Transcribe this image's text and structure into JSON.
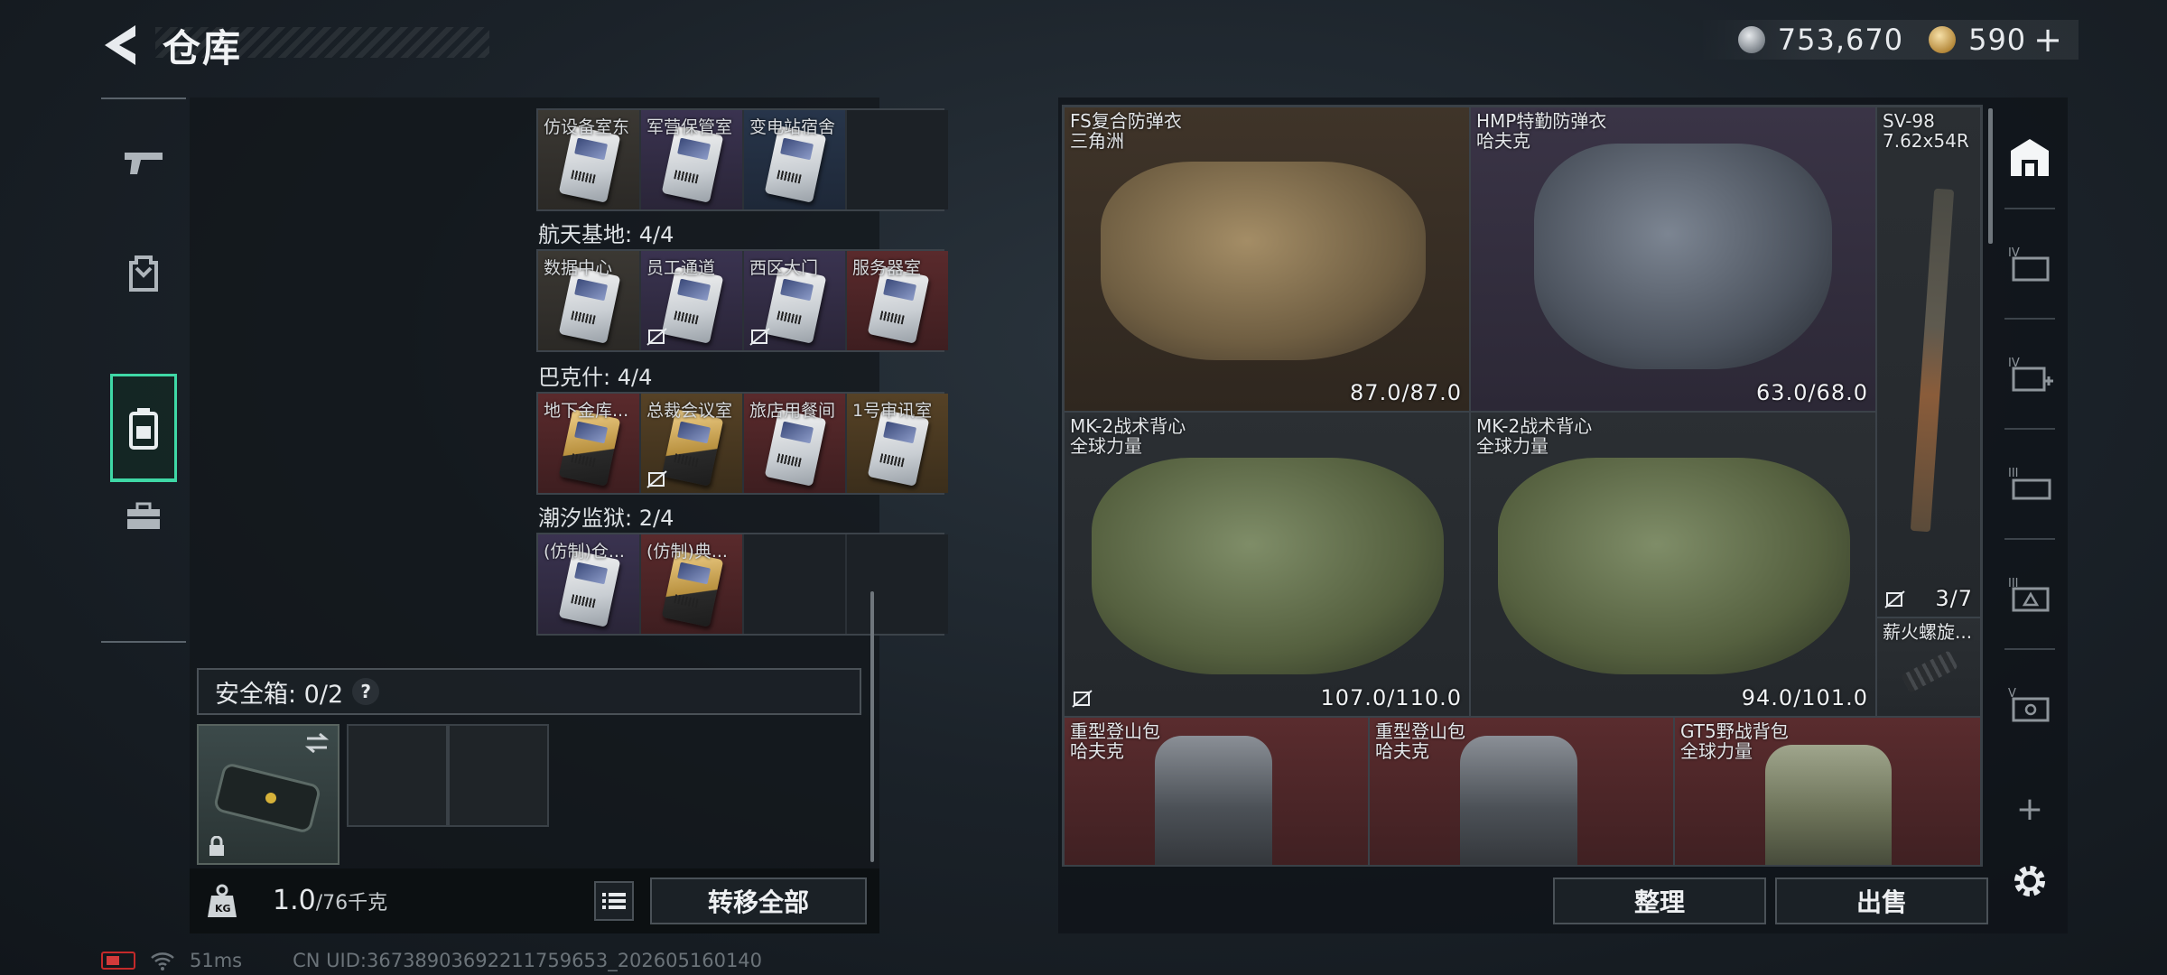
{
  "header": {
    "title": "仓库"
  },
  "currency": {
    "silver": "753,670",
    "gold": "590",
    "plus": "+"
  },
  "keys": {
    "row0": [
      {
        "label": "仿设备室东",
        "color": "grey",
        "card": "white",
        "nodrop": false
      },
      {
        "label": "军营保管室",
        "color": "purple",
        "card": "white",
        "nodrop": false
      },
      {
        "label": "变电站宿舍",
        "color": "blue",
        "card": "white",
        "nodrop": false
      },
      {
        "label": "",
        "color": "empty"
      }
    ],
    "groups": [
      {
        "title": "航天基地: 4/4",
        "cells": [
          {
            "label": "数据中心",
            "color": "grey",
            "card": "white",
            "nodrop": false
          },
          {
            "label": "员工通道",
            "color": "purple",
            "card": "white",
            "nodrop": true
          },
          {
            "label": "西区大门",
            "color": "purple",
            "card": "white",
            "nodrop": true
          },
          {
            "label": "服务器室",
            "color": "red",
            "card": "white",
            "nodrop": false
          }
        ]
      },
      {
        "title": "巴克什: 4/4",
        "cells": [
          {
            "label": "地下金库...",
            "color": "red",
            "card": "gold",
            "nodrop": false
          },
          {
            "label": "总裁会议室",
            "color": "gold",
            "card": "gold",
            "nodrop": true
          },
          {
            "label": "旅店用餐间",
            "color": "red",
            "card": "white",
            "nodrop": false
          },
          {
            "label": "1号审讯室",
            "color": "gold",
            "card": "white",
            "nodrop": false
          }
        ]
      },
      {
        "title": "潮汐监狱: 2/4",
        "cells": [
          {
            "label": "(仿制)仓...",
            "color": "purple",
            "card": "white",
            "nodrop": false
          },
          {
            "label": "(仿制)典...",
            "color": "red",
            "card": "gold",
            "nodrop": false
          },
          {
            "label": "",
            "color": "empty"
          },
          {
            "label": "",
            "color": "empty"
          }
        ]
      }
    ]
  },
  "safe": {
    "label": "安全箱: 0/2",
    "help": "?"
  },
  "footer": {
    "weight": "1.0",
    "capacity": "/76千克",
    "transfer": "转移全部"
  },
  "status": {
    "latency": "51ms",
    "uid": "CN UID:36738903692211759653_202605160140"
  },
  "stash": {
    "items": [
      {
        "name": "FS复合防弹衣",
        "sub": "三角洲",
        "dur": "87.0/87.0",
        "bg": "brown"
      },
      {
        "name": "HMP特勤防弹衣",
        "sub": "哈夫克",
        "dur": "63.0/68.0",
        "bg": "purple"
      },
      {
        "name": "SV-98",
        "sub": "7.62x54R",
        "dur": "3/7",
        "bg": "dgrey"
      },
      {
        "name": "MK-2战术背心",
        "sub": "全球力量",
        "dur": "107.0/110.0",
        "bg": "dgrey"
      },
      {
        "name": "MK-2战术背心",
        "sub": "全球力量",
        "dur": "94.0/101.0",
        "bg": "dgrey"
      },
      {
        "name": "薪火螺旋...",
        "sub": "",
        "dur": "",
        "bg": "dgrey"
      },
      {
        "name": "重型登山包",
        "sub": "哈夫克",
        "dur": "",
        "bg": "red"
      },
      {
        "name": "重型登山包",
        "sub": "哈夫克",
        "dur": "",
        "bg": "red"
      },
      {
        "name": "GT5野战背包",
        "sub": "全球力量",
        "dur": "",
        "bg": "red"
      }
    ]
  },
  "rightnav": {
    "tabs": [
      "IV",
      "IV",
      "III",
      "III",
      "V"
    ],
    "add": "+"
  },
  "actions": {
    "sort": "整理",
    "sell": "出售"
  }
}
